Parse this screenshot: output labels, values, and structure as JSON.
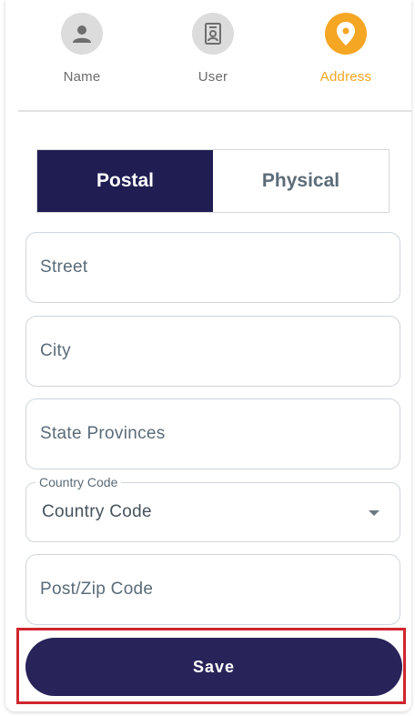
{
  "stepper": {
    "steps": [
      {
        "label": "Name",
        "icon": "person-icon",
        "active": false
      },
      {
        "label": "User",
        "icon": "contact-card-icon",
        "active": false
      },
      {
        "label": "Address",
        "icon": "location-pin-icon",
        "active": true
      }
    ],
    "active_color": "#f5a623",
    "inactive_color": "#dcdcdc"
  },
  "address_type_toggle": {
    "options": [
      "Postal",
      "Physical"
    ],
    "selected": "Postal",
    "active_color": "#1f1d52"
  },
  "form": {
    "street": {
      "placeholder": "Street",
      "value": ""
    },
    "city": {
      "placeholder": "City",
      "value": ""
    },
    "state": {
      "placeholder": "State Provinces",
      "value": ""
    },
    "country_code": {
      "legend": "Country Code",
      "value": "Country Code"
    },
    "post_code": {
      "placeholder": "Post/Zip Code",
      "value": ""
    }
  },
  "actions": {
    "save_label": "Save",
    "save_color": "#28245a",
    "highlight_color": "#d0262d"
  }
}
